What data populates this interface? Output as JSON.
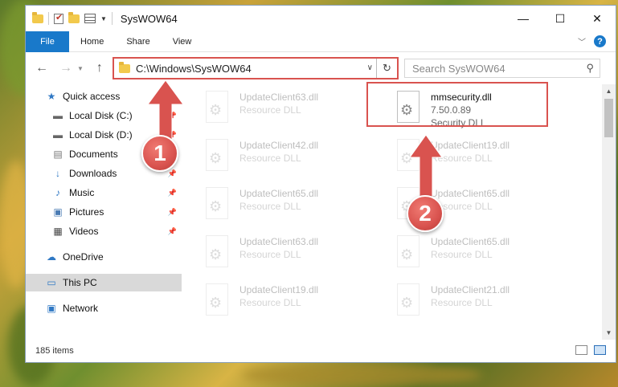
{
  "window": {
    "title": "SysWOW64",
    "controls": {
      "minimize": "—",
      "maximize": "☐",
      "close": "✕"
    }
  },
  "ribbon": {
    "file_tab": "File",
    "tabs": [
      "Home",
      "Share",
      "View"
    ]
  },
  "nav": {
    "address": "C:\\Windows\\SysWOW64",
    "search_placeholder": "Search SysWOW64"
  },
  "sidebar": {
    "items": [
      {
        "label": "Quick access",
        "icon": "star-icon",
        "pinned": false
      },
      {
        "label": "Local Disk (C:)",
        "icon": "drive-icon",
        "pinned": true
      },
      {
        "label": "Local Disk (D:)",
        "icon": "drive-icon",
        "pinned": true
      },
      {
        "label": "Documents",
        "icon": "documents-icon",
        "pinned": true
      },
      {
        "label": "Downloads",
        "icon": "download-icon",
        "pinned": true
      },
      {
        "label": "Music",
        "icon": "music-icon",
        "pinned": true
      },
      {
        "label": "Pictures",
        "icon": "pictures-icon",
        "pinned": true
      },
      {
        "label": "Videos",
        "icon": "videos-icon",
        "pinned": true
      },
      {
        "label": "OneDrive",
        "icon": "cloud-icon",
        "pinned": false
      },
      {
        "label": "This PC",
        "icon": "monitor-icon",
        "pinned": false
      },
      {
        "label": "Network",
        "icon": "network-icon",
        "pinned": false
      }
    ]
  },
  "files": [
    {
      "name": "UpdateClient63.dll",
      "sub": "Resource DLL",
      "faded": true
    },
    {
      "name": "mmsecurity.dll",
      "sub": "7.50.0.89",
      "sub2": "Security DLL",
      "faded": false
    },
    {
      "name": "UpdateClient42.dll",
      "sub": "Resource DLL",
      "faded": true
    },
    {
      "name": "UpdateClient19.dll",
      "sub": "Resource DLL",
      "faded": true
    },
    {
      "name": "UpdateClient65.dll",
      "sub": "Resource DLL",
      "faded": true
    },
    {
      "name": "UpdateClient65.dll",
      "sub": "Resource DLL",
      "faded": true
    },
    {
      "name": "UpdateClient63.dll",
      "sub": "Resource DLL",
      "faded": true
    },
    {
      "name": "UpdateClient65.dll",
      "sub": "Resource DLL",
      "faded": true
    },
    {
      "name": "UpdateClient19.dll",
      "sub": "Resource DLL",
      "faded": true
    },
    {
      "name": "UpdateClient21.dll",
      "sub": "Resource DLL",
      "faded": true
    }
  ],
  "status": {
    "item_count": "185 items"
  },
  "annotations": {
    "step1": "1",
    "step2": "2"
  },
  "colors": {
    "accent": "#1979ca",
    "highlight": "#d9534f"
  }
}
